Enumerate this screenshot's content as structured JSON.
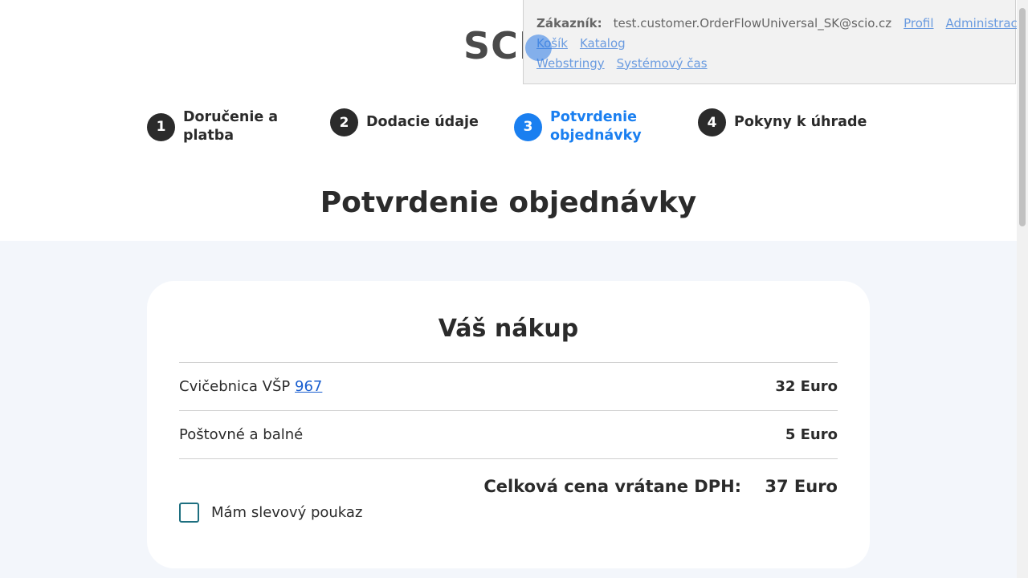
{
  "logo": "SCI",
  "steps": [
    {
      "num": "1",
      "label": "Doručenie a platba"
    },
    {
      "num": "2",
      "label": "Dodacie údaje"
    },
    {
      "num": "3",
      "label": "Potvrdenie objednávky"
    },
    {
      "num": "4",
      "label": "Pokyny k úhrade"
    }
  ],
  "page_title": "Potvrdenie objednávky",
  "card": {
    "title": "Váš nákup",
    "items": [
      {
        "name": "Cvičebnica VŠP",
        "link": "967",
        "price": "32 Euro"
      },
      {
        "name": "Poštovné a balné",
        "price": "5 Euro"
      }
    ],
    "total_label": "Celková cena vrátane DPH:",
    "total_value": "37 Euro",
    "voucher_label": "Mám slevový poukaz"
  },
  "dev_panel": {
    "customer_label": "Zákazník:",
    "customer_email": "test.customer.OrderFlowUniversal_SK@scio.cz",
    "links": [
      "Profil",
      "Administrace",
      "Košík",
      "Katalog",
      "Webstringy",
      "Systémový čas"
    ]
  },
  "colors": {
    "accent": "#1a7ff0",
    "background": "#f3f6fb"
  }
}
